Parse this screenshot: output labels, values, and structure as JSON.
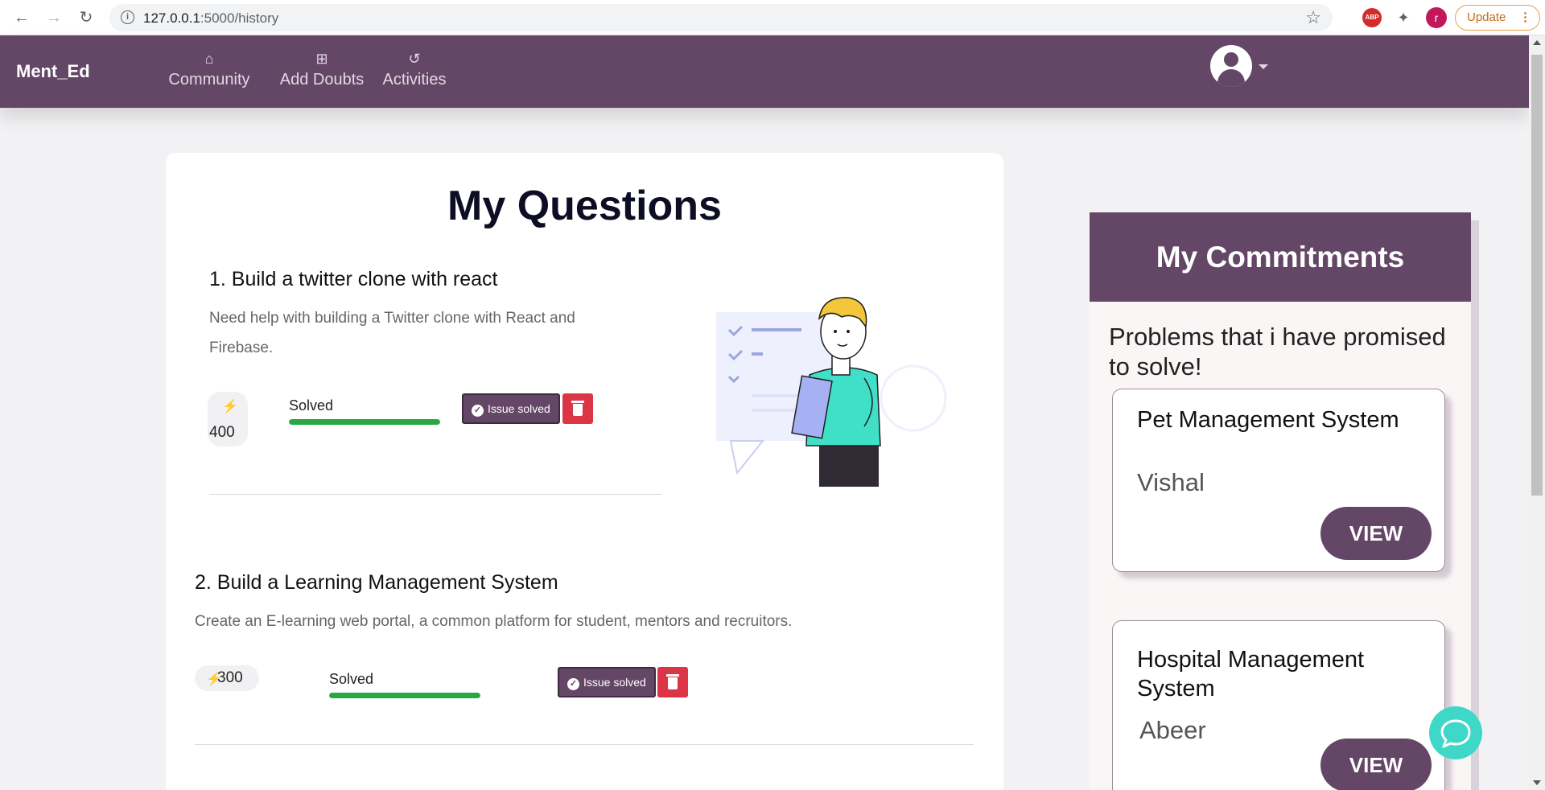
{
  "browser": {
    "url_host": "127.0.0.1",
    "url_path": ":5000/history",
    "update_label": "Update",
    "profile_initial": "r",
    "abp_label": "ABP"
  },
  "navbar": {
    "brand": "Ment_Ed",
    "items": [
      {
        "label": "Community",
        "icon": "home-icon"
      },
      {
        "label": "Add Doubts",
        "icon": "plus-square-icon"
      },
      {
        "label": "Activities",
        "icon": "history-icon"
      }
    ],
    "bg_color": "#644766"
  },
  "main": {
    "title": "My Questions",
    "questions": [
      {
        "title": "1. Build a twitter clone with react",
        "description": "Need help with building a Twitter clone with React and Firebase.",
        "points": "400",
        "status": "Solved",
        "progress": 1.0,
        "solved_label": "Issue solved"
      },
      {
        "title": "2. Build a Learning Management System",
        "description": "Create an E-learning web portal, a common platform for student, mentors and recruitors.",
        "points": "300",
        "status": "Solved",
        "progress": 1.0,
        "solved_label": "Issue solved"
      }
    ]
  },
  "commitments": {
    "heading": "My Commitments",
    "subtitle": "Problems that i have promised to solve!",
    "cards": [
      {
        "title": "Pet Management System",
        "name": "Vishal",
        "button": "VIEW"
      },
      {
        "title": "Hospital Management System",
        "name": "Abeer",
        "button": "VIEW"
      }
    ]
  },
  "colors": {
    "accent": "#644766",
    "success": "#28a745",
    "danger": "#dc3545",
    "chat": "#3fd8c8"
  }
}
